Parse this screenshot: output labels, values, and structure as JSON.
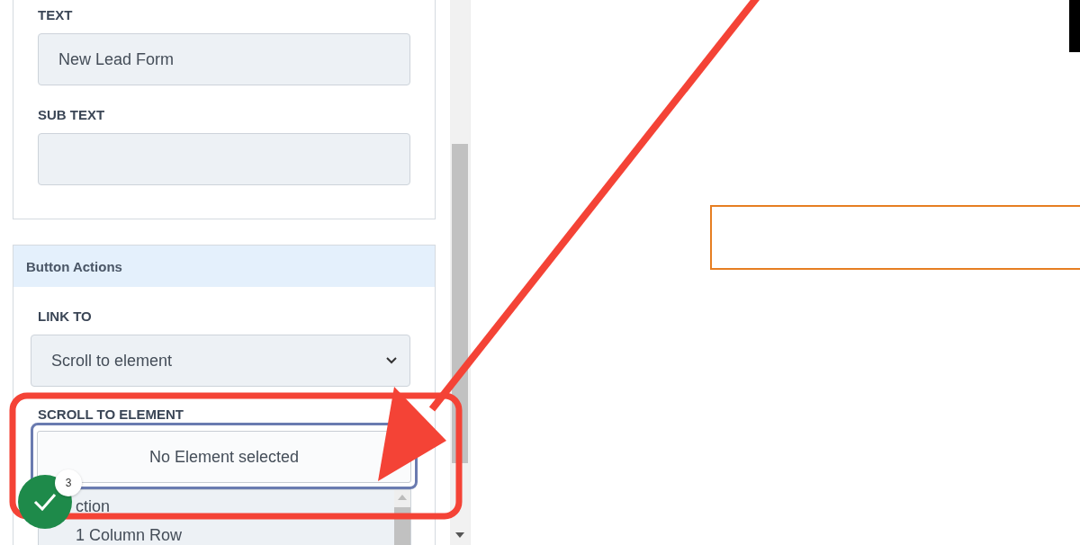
{
  "panel": {
    "text_field": {
      "label": "TEXT",
      "value": "New Lead Form"
    },
    "sub_text_field": {
      "label": "SUB TEXT"
    },
    "button_actions": {
      "title": "Button Actions",
      "link_to": {
        "label": "LINK TO",
        "value": "Scroll to element"
      },
      "scroll_to_element": {
        "label": "SCROLL TO ELEMENT",
        "value": "No Element selected",
        "expanded": true,
        "options": [
          "ction",
          "1 Column Row"
        ]
      }
    }
  },
  "badge": {
    "count": "3"
  }
}
